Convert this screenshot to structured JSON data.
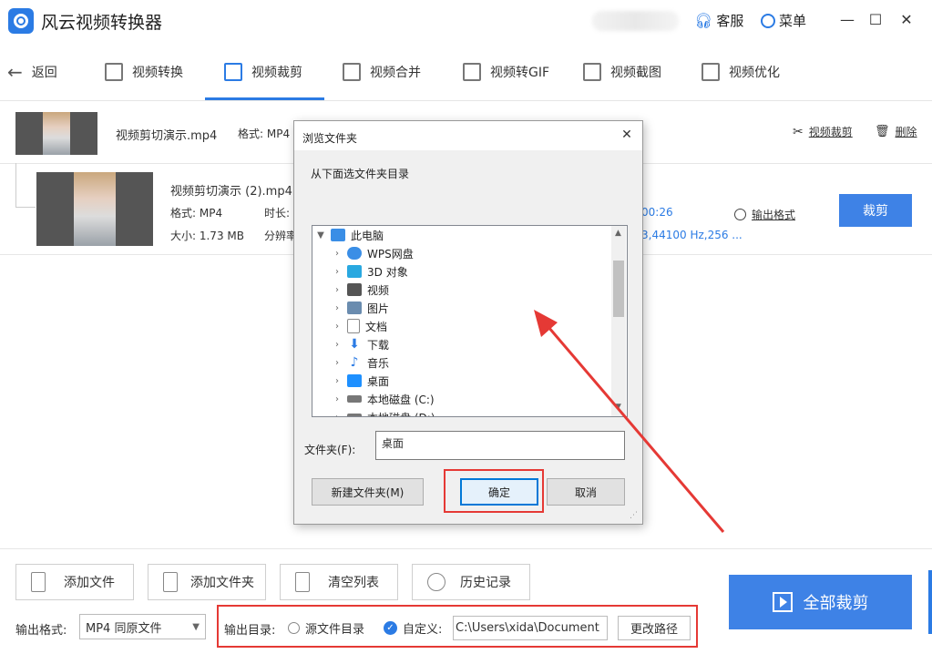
{
  "app": {
    "title": "风云视频转换器",
    "service_label": "客服",
    "menu_label": "菜单",
    "min": "—",
    "max": "☐",
    "close": "✕"
  },
  "nav": {
    "back_label": "返回",
    "tabs": [
      {
        "label": "视频转换"
      },
      {
        "label": "视频裁剪"
      },
      {
        "label": "视频合并"
      },
      {
        "label": "视频转GIF"
      },
      {
        "label": "视频截图"
      },
      {
        "label": "视频优化"
      }
    ]
  },
  "file1": {
    "name": "视频剪切演示.mp4",
    "format_label": "格式: MP4",
    "crop_link": "视频裁剪",
    "delete_link": "删除"
  },
  "file2": {
    "name": "视频剪切演示 (2).mp4",
    "format": "格式: MP4",
    "duration": "时长: (",
    "size": "大小: 1.73 MB",
    "resolution": "分辨率",
    "time_right": "00:26",
    "audio_info": "3,44100 Hz,256 ...",
    "output_format_link": "输出格式",
    "crop_button": "裁剪"
  },
  "bottom": {
    "add_file": "添加文件",
    "add_folder": "添加文件夹",
    "clear_list": "清空列表",
    "history": "历史记录",
    "output_format_label": "输出格式:",
    "output_format_value": "MP4 同原文件",
    "output_dir_label": "输出目录:",
    "source_dir_option": "源文件目录",
    "custom_option": "自定义:",
    "custom_path": "C:\\Users\\xida\\Document",
    "change_path": "更改路径",
    "crop_all": "全部裁剪"
  },
  "dialog": {
    "title": "浏览文件夹",
    "instruction": "从下面选文件夹目录",
    "tree": [
      {
        "label": "此电脑",
        "icon": "computer-icon",
        "color": "#3a8ee6"
      },
      {
        "label": "WPS网盘",
        "icon": "cloud-icon",
        "color": "#3a8ee6"
      },
      {
        "label": "3D 对象",
        "icon": "cube-icon",
        "color": "#29a8e0"
      },
      {
        "label": "视频",
        "icon": "film-icon",
        "color": "#555555"
      },
      {
        "label": "图片",
        "icon": "picture-icon",
        "color": "#6a8caf"
      },
      {
        "label": "文档",
        "icon": "document-icon",
        "color": "#8a8a8a"
      },
      {
        "label": "下载",
        "icon": "download-icon",
        "color": "#2b7be4"
      },
      {
        "label": "音乐",
        "icon": "music-icon",
        "color": "#2b7be4"
      },
      {
        "label": "桌面",
        "icon": "desktop-icon",
        "color": "#1e90ff"
      },
      {
        "label": "本地磁盘 (C:)",
        "icon": "disk-icon",
        "color": "#777777"
      },
      {
        "label": "本地磁盘 (D:)",
        "icon": "disk-icon",
        "color": "#777777"
      }
    ],
    "folder_label": "文件夹(F):",
    "folder_value": "桌面",
    "new_folder": "新建文件夹(M)",
    "ok": "确定",
    "cancel": "取消"
  },
  "colors": {
    "accent": "#2b7be4",
    "highlight": "#e53935"
  }
}
